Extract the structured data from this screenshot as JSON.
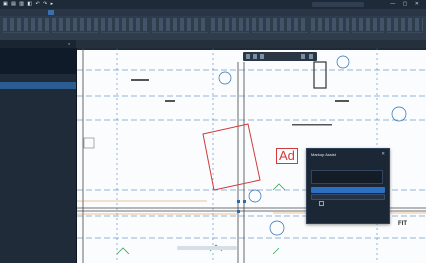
{
  "titlebar": {
    "qat": "▣ ▤ ▥ ◧ ↶ ↷ ▸",
    "title": "",
    "win_controls": "— ▢ ✕"
  },
  "menubar": {
    "items": [
      "",
      "",
      "",
      "",
      "",
      "",
      "",
      "",
      "",
      ""
    ],
    "active_index": 7
  },
  "ribbon": {
    "groups": [
      "",
      "",
      "",
      "",
      "",
      "",
      "",
      "",
      ""
    ]
  },
  "doctab": {
    "label": "",
    "close": "×"
  },
  "panel": {
    "rows": [
      {
        "k": "",
        "v": ""
      },
      {
        "k": "",
        "v": ""
      },
      {
        "k": "",
        "v": ""
      }
    ]
  },
  "canvas": {
    "view_title": "",
    "big_text": "Ad",
    "fit_text": "FIT"
  },
  "dialog": {
    "title": "Markup Assist",
    "close": "✕",
    "field_label": "",
    "field_value": "",
    "btn_primary": "",
    "btn_secondary": "",
    "check_label": "",
    "link": ""
  },
  "colors": {
    "accent": "#2d6fc0",
    "markup_red": "#d23b3b",
    "dialog_bg": "#1c2735",
    "panel_bg": "#1f2b39"
  }
}
